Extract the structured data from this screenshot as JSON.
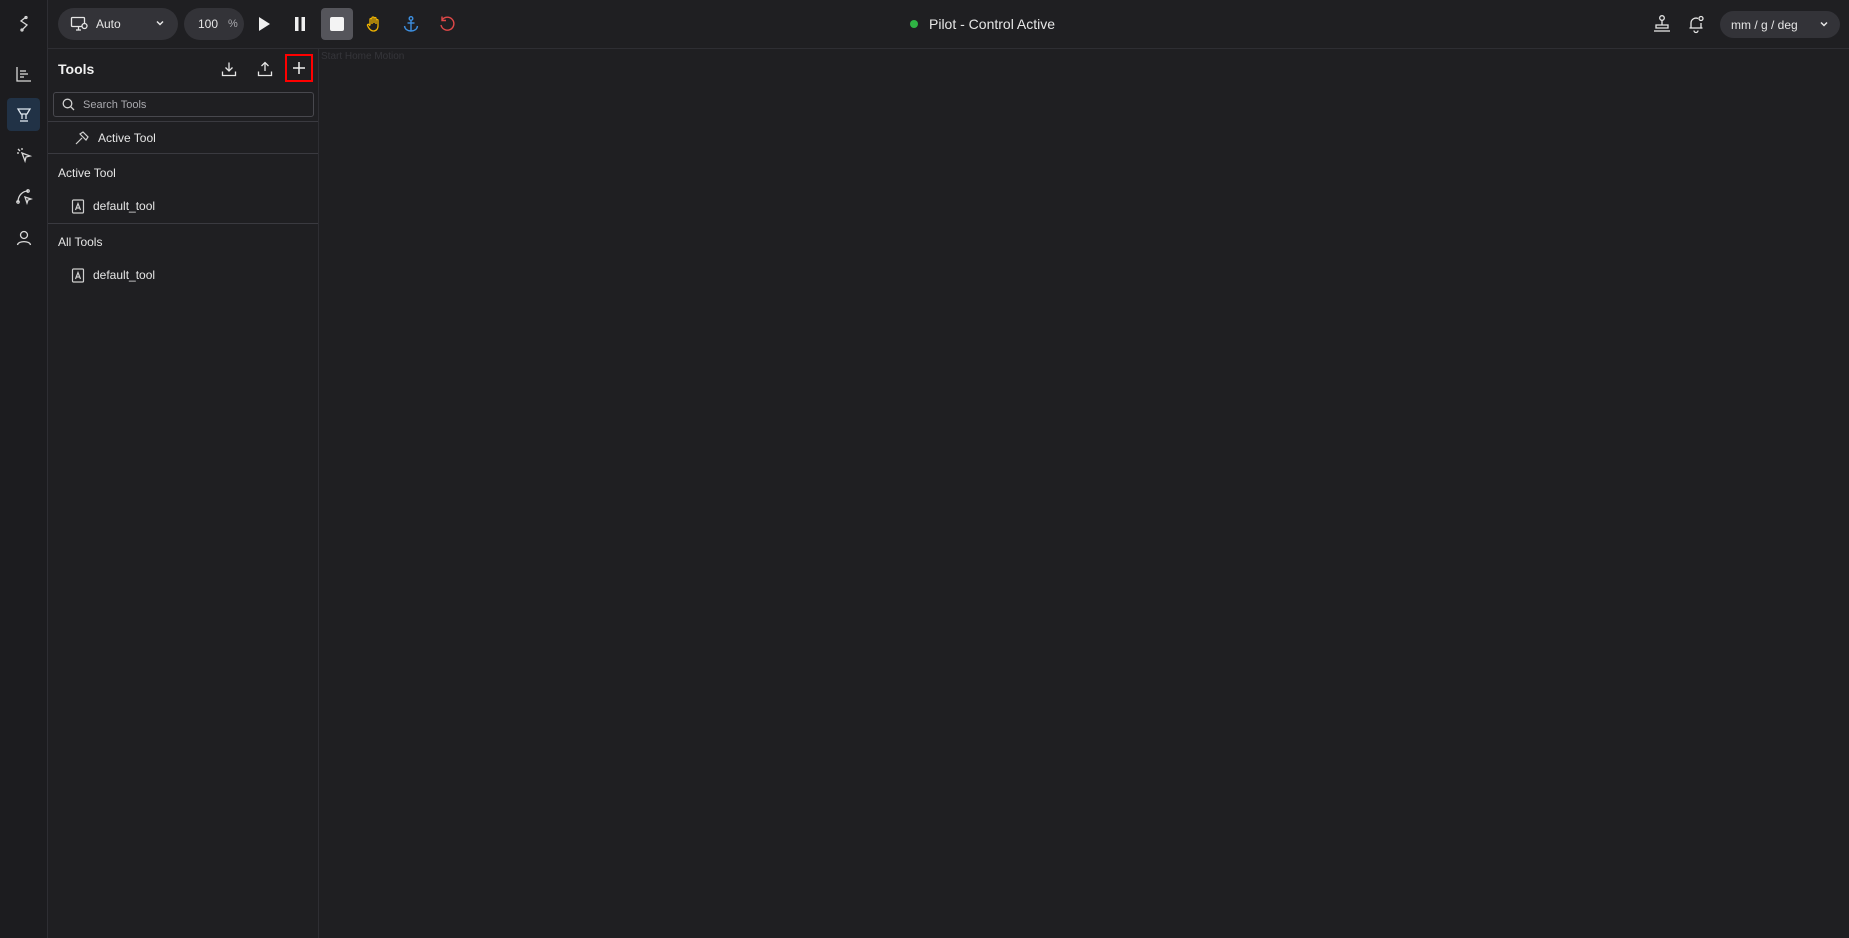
{
  "toolbar": {
    "mode_label": "Auto",
    "speed_value": "100",
    "speed_unit": "%",
    "status_text": "Pilot - Control Active",
    "status_color": "#2fb344",
    "ghost_text": "Start Home Motion",
    "units_label": "mm / g / deg",
    "icons": {
      "mode": "monitor-icon",
      "play": "play-icon",
      "pause": "pause-icon",
      "stop": "stop-icon",
      "hand": "hand-icon",
      "anchor": "anchor-icon",
      "reset": "reset-icon",
      "robot": "robot-arm-icon",
      "notifications": "bell-icon"
    },
    "colors": {
      "hand": "#f0b400",
      "anchor": "#3d8fe0",
      "reset": "#e04848"
    }
  },
  "rail": {
    "items": [
      {
        "name": "logo",
        "icon": "logo-icon"
      },
      {
        "name": "charts",
        "icon": "chart-icon"
      },
      {
        "name": "tools",
        "icon": "tool-icon",
        "active": true
      },
      {
        "name": "teach",
        "icon": "pointer-icon"
      },
      {
        "name": "paths",
        "icon": "path-icon"
      },
      {
        "name": "user",
        "icon": "user-icon"
      }
    ]
  },
  "tools_panel": {
    "title": "Tools",
    "search_placeholder": "Search Tools",
    "active_tool_item": "Active Tool",
    "active_section_label": "Active Tool",
    "active_tool_name": "default_tool",
    "all_section_label": "All Tools",
    "all_tools": [
      "default_tool"
    ]
  }
}
